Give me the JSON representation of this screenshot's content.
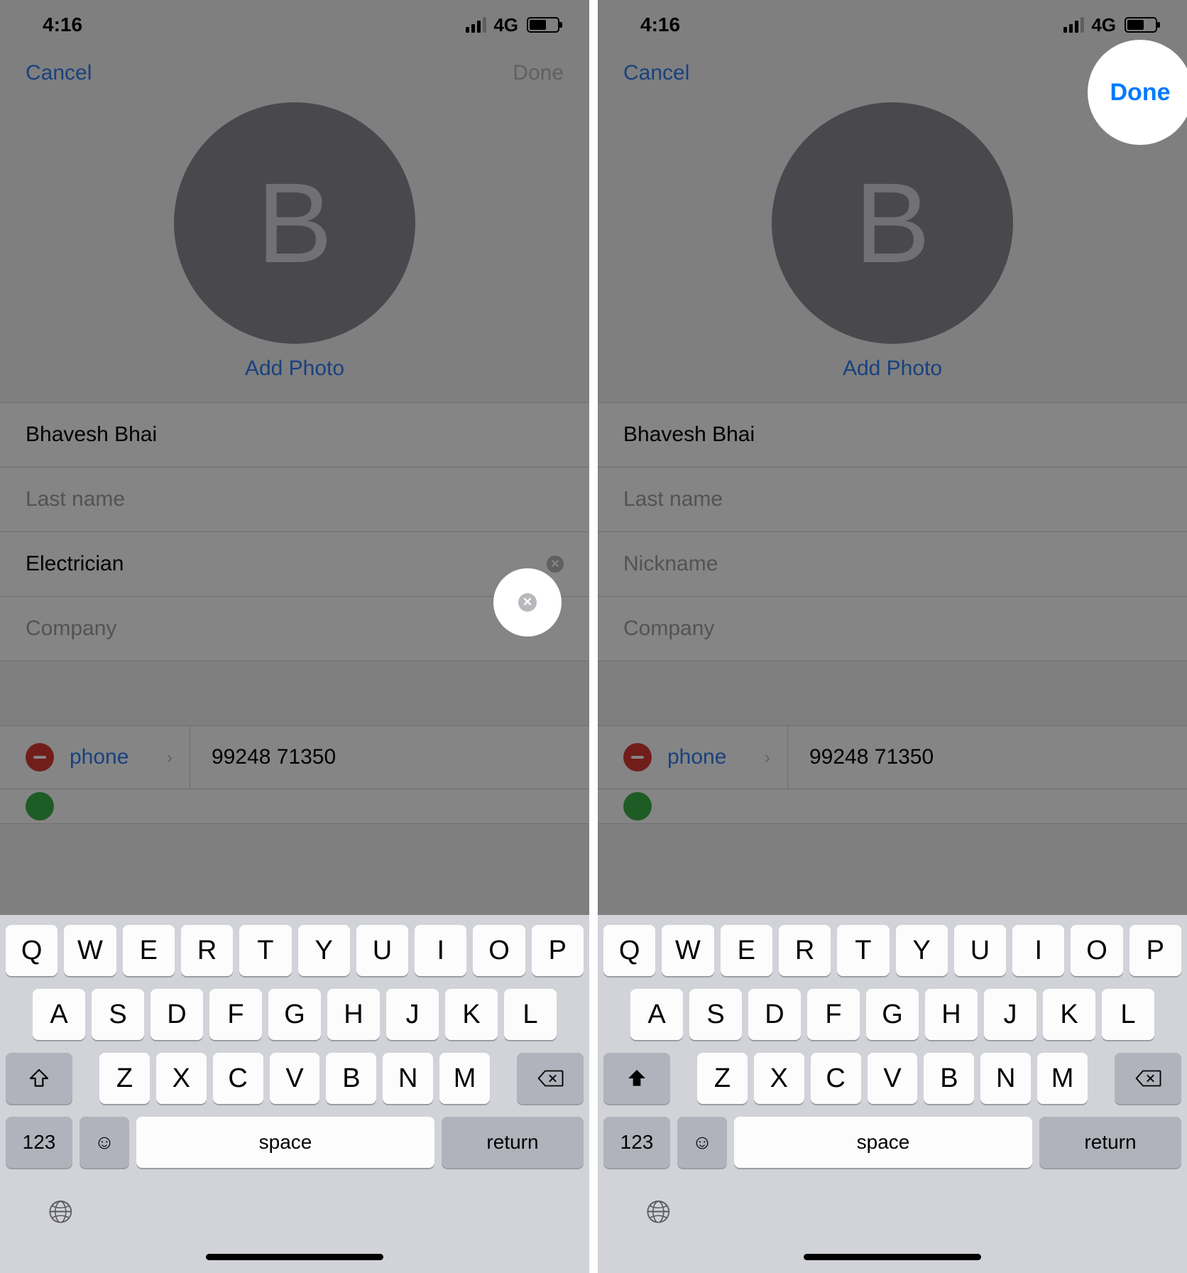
{
  "status": {
    "time": "4:16",
    "network": "4G"
  },
  "nav": {
    "cancel": "Cancel",
    "done": "Done"
  },
  "avatar": {
    "initial": "B",
    "add_photo": "Add Photo"
  },
  "left": {
    "fields": {
      "first_name": "Bhavesh Bhai",
      "last_name_ph": "Last name",
      "nickname": "Electrician",
      "company_ph": "Company"
    },
    "highlight": "clear"
  },
  "right": {
    "fields": {
      "first_name": "Bhavesh Bhai",
      "last_name_ph": "Last name",
      "nickname_ph": "Nickname",
      "company_ph": "Company"
    },
    "highlight": "done"
  },
  "phone": {
    "type": "phone",
    "number": "99248 71350"
  },
  "keyboard": {
    "row1": [
      "Q",
      "W",
      "E",
      "R",
      "T",
      "Y",
      "U",
      "I",
      "O",
      "P"
    ],
    "row2": [
      "A",
      "S",
      "D",
      "F",
      "G",
      "H",
      "J",
      "K",
      "L"
    ],
    "row3": [
      "Z",
      "X",
      "C",
      "V",
      "B",
      "N",
      "M"
    ],
    "numkey": "123",
    "space": "space",
    "return": "return"
  }
}
